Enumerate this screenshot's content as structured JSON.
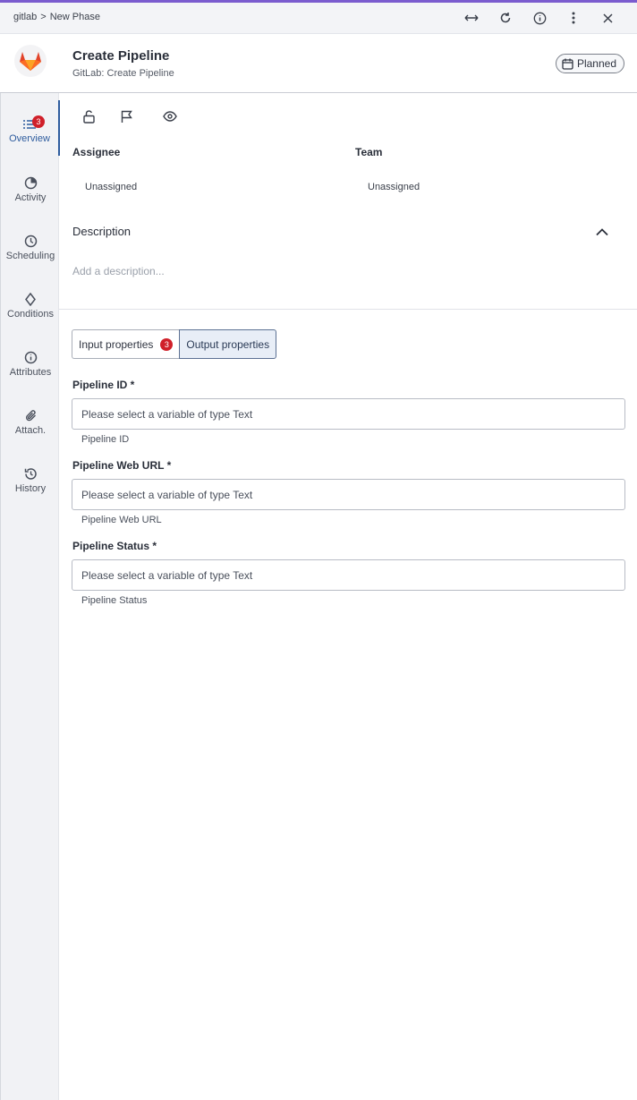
{
  "colors": {
    "accent": "#7b5ccf",
    "badge": "#d0202a",
    "active": "#2e5c9e"
  },
  "breadcrumb": {
    "root": "gitlab",
    "separator": ">",
    "current": "New Phase"
  },
  "top_icons": [
    "expand-horizontal-icon",
    "refresh-icon",
    "info-icon",
    "more-vertical-icon",
    "close-icon"
  ],
  "header": {
    "title": "Create Pipeline",
    "subtitle": "GitLab: Create Pipeline",
    "status": "Planned"
  },
  "sidebar": {
    "items": [
      {
        "label": "Overview",
        "icon": "list-icon",
        "badge": "3",
        "active": true
      },
      {
        "label": "Activity",
        "icon": "activity-icon"
      },
      {
        "label": "Scheduling",
        "icon": "clock-icon"
      },
      {
        "label": "Conditions",
        "icon": "diamond-icon"
      },
      {
        "label": "Attributes",
        "icon": "info-icon"
      },
      {
        "label": "Attach.",
        "icon": "paperclip-icon"
      },
      {
        "label": "History",
        "icon": "history-icon"
      }
    ]
  },
  "toolbar": [
    "lock-icon",
    "flag-icon",
    "eye-icon"
  ],
  "assignee": {
    "label": "Assignee",
    "value": "Unassigned"
  },
  "team": {
    "label": "Team",
    "value": "Unassigned"
  },
  "description": {
    "title": "Description",
    "placeholder": "Add a description..."
  },
  "tabs": [
    {
      "label": "Input properties",
      "badge": "3"
    },
    {
      "label": "Output properties",
      "active": true
    }
  ],
  "properties": [
    {
      "label": "Pipeline ID *",
      "placeholder": "Please select a variable of type Text",
      "help": "Pipeline ID"
    },
    {
      "label": "Pipeline Web URL *",
      "placeholder": "Please select a variable of type Text",
      "help": "Pipeline Web URL"
    },
    {
      "label": "Pipeline Status *",
      "placeholder": "Please select a variable of type Text",
      "help": "Pipeline Status"
    }
  ]
}
